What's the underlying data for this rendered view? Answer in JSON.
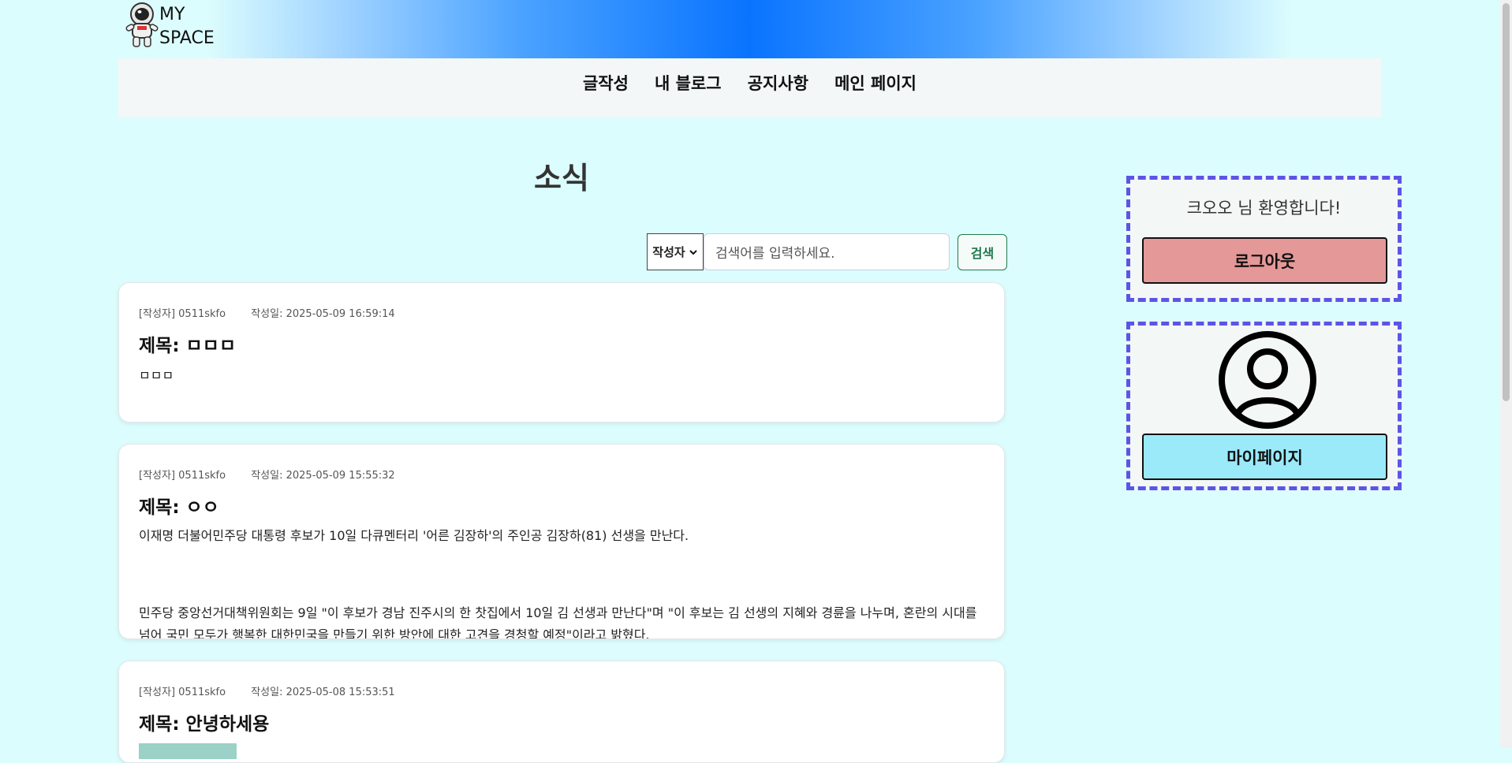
{
  "header": {
    "logo_line1": "MY",
    "logo_line2": "SPACE",
    "gradient_center": "#0a74ff"
  },
  "nav": {
    "items": [
      {
        "label": "글작성"
      },
      {
        "label": "내 블로그"
      },
      {
        "label": "공지사항"
      },
      {
        "label": "메인 페이지"
      }
    ]
  },
  "main": {
    "title": "소식",
    "search": {
      "select_value": "작성자",
      "placeholder": "검색어를 입력하세요.",
      "button_label": "검색"
    },
    "posts": [
      {
        "author": "[작성자] 0511skfo",
        "date": "작성일: 2025-05-09 16:59:14",
        "title": "제목: ㅁㅁㅁ",
        "body": [
          "ㅁㅁㅁ"
        ]
      },
      {
        "author": "[작성자] 0511skfo",
        "date": "작성일: 2025-05-09 15:55:32",
        "title": "제목: ㅇㅇ",
        "body": [
          "이재명 더불어민주당 대통령 후보가 10일 다큐멘터리 '어른 김장하'의 주인공 김장하(81) 선생을 만난다.",
          "민주당 중앙선거대책위원회는 9일 \"이 후보가 경남 진주시의 한 찻집에서 10일 김 선생과 만난다\"며 \"이 후보는 김 선생의 지혜와 경륜을 나누며, 혼란의 시대를 넘어 국민 모두가 행복한 대한민국을 만들기 위한 방안에 대한 고견을 경청할 예정\"이라고 밝혔다."
        ]
      },
      {
        "author": "[작성자] 0511skfo",
        "date": "작성일: 2025-05-08 15:53:51",
        "title": "제목: 안녕하세용",
        "body": []
      }
    ]
  },
  "sidebar": {
    "welcome": "크오오 님 환영합니다!",
    "logout_label": "로그아웃",
    "mypage_label": "마이페이지",
    "profile_icon": "user-circle-icon",
    "box_border_color": "#5b55e6",
    "logout_color": "#e59898",
    "mypage_color": "#9aeafa"
  }
}
